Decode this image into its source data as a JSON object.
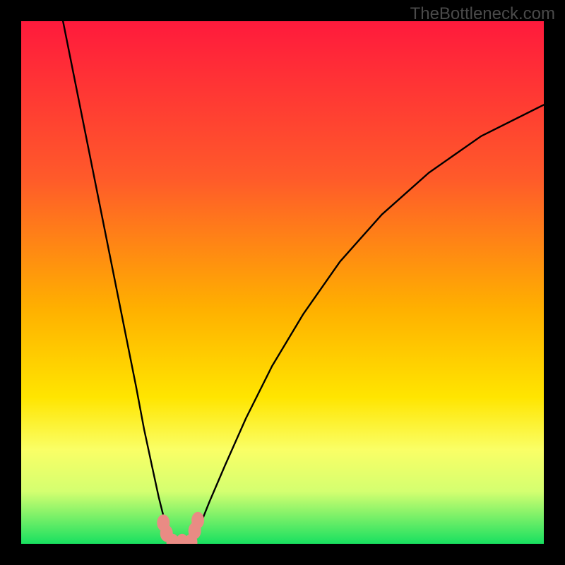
{
  "watermark": "TheBottleneck.com",
  "chart_data": {
    "type": "line",
    "title": "",
    "xlabel": "",
    "ylabel": "",
    "xlim": [
      0,
      100
    ],
    "ylim": [
      0,
      100
    ],
    "gradient_stops": [
      {
        "offset": 0,
        "color": "#ff1a3c"
      },
      {
        "offset": 30,
        "color": "#ff5a2a"
      },
      {
        "offset": 55,
        "color": "#ffb000"
      },
      {
        "offset": 72,
        "color": "#ffe500"
      },
      {
        "offset": 82,
        "color": "#faff66"
      },
      {
        "offset": 90,
        "color": "#d4ff70"
      },
      {
        "offset": 100,
        "color": "#18e060"
      }
    ],
    "series": [
      {
        "name": "left-curve",
        "x": [
          8,
          10,
          12,
          14,
          16,
          18,
          20,
          22,
          23.5,
          25,
          26.3,
          27.3,
          28,
          28.4
        ],
        "y": [
          100,
          90,
          80,
          70,
          60,
          50,
          40,
          30,
          22,
          15,
          9,
          5,
          2,
          0
        ]
      },
      {
        "name": "right-curve",
        "x": [
          33,
          34,
          36,
          39,
          43,
          48,
          54,
          61,
          69,
          78,
          88,
          100
        ],
        "y": [
          0,
          3,
          8,
          15,
          24,
          34,
          44,
          54,
          63,
          71,
          78,
          84
        ]
      }
    ],
    "flat_segment": {
      "x0": 28.4,
      "x1": 33.0,
      "y": 0
    },
    "markers": [
      {
        "x": 27.2,
        "y": 4.0
      },
      {
        "x": 27.8,
        "y": 2.0
      },
      {
        "x": 33.2,
        "y": 2.5
      },
      {
        "x": 33.8,
        "y": 4.5
      },
      {
        "x": 29.0,
        "y": 0.3
      },
      {
        "x": 30.8,
        "y": 0.3
      },
      {
        "x": 32.5,
        "y": 0.3
      }
    ],
    "marker_color": "#e98b84"
  }
}
